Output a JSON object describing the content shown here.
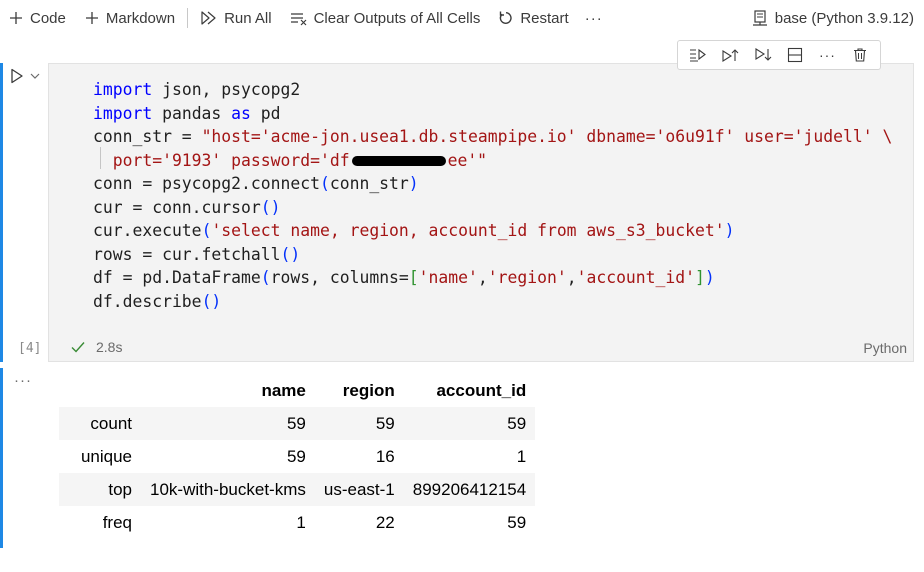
{
  "toolbar": {
    "code_label": "Code",
    "markdown_label": "Markdown",
    "run_all_label": "Run All",
    "clear_outputs_label": "Clear Outputs of All Cells",
    "restart_label": "Restart",
    "more_label": "···",
    "kernel_label": "base (Python 3.9.12)"
  },
  "cell": {
    "execution_count": "[4]",
    "duration": "2.8s",
    "language": "Python",
    "code": {
      "l1_kw": "import",
      "l1_rest": " json, psycopg2",
      "l2_kw1": "import",
      "l2_mid": " pandas ",
      "l2_kw2": "as",
      "l2_rest": " pd",
      "l3_pre": "conn_str = ",
      "l3_str": "\"host='acme-jon.usea1.db.steampipe.io' dbname='o6u91f' user='judell' \\",
      "l4_str_a": "  port='9193' password='df",
      "l4_str_b": "ee'\"",
      "l5_pre": "conn = psycopg2.connect",
      "l5_arg": "conn_str",
      "l6_pre": "cur = conn.cursor",
      "l7_pre": "cur.execute",
      "l7_str": "'select name, region, account_id from aws_s3_bucket'",
      "l8_pre": "rows = cur.fetchall",
      "l9_pre": "df = pd.DataFrame",
      "l9_arg": "rows, columns=",
      "l9_s1": "'name'",
      "l9_s2": "'region'",
      "l9_s3": "'account_id'",
      "l10_pre": "df.describe"
    }
  },
  "output": {
    "dots": "···",
    "columns": [
      "name",
      "region",
      "account_id"
    ],
    "rows": [
      {
        "label": "count",
        "values": [
          "59",
          "59",
          "59"
        ]
      },
      {
        "label": "unique",
        "values": [
          "59",
          "16",
          "1"
        ]
      },
      {
        "label": "top",
        "values": [
          "10k-with-bucket-kms",
          "us-east-1",
          "899206412154"
        ]
      },
      {
        "label": "freq",
        "values": [
          "1",
          "22",
          "59"
        ]
      }
    ]
  },
  "colors": {
    "accent": "#1e88e5",
    "keyword": "#0000ff",
    "string": "#a31515",
    "success": "#388a34"
  }
}
